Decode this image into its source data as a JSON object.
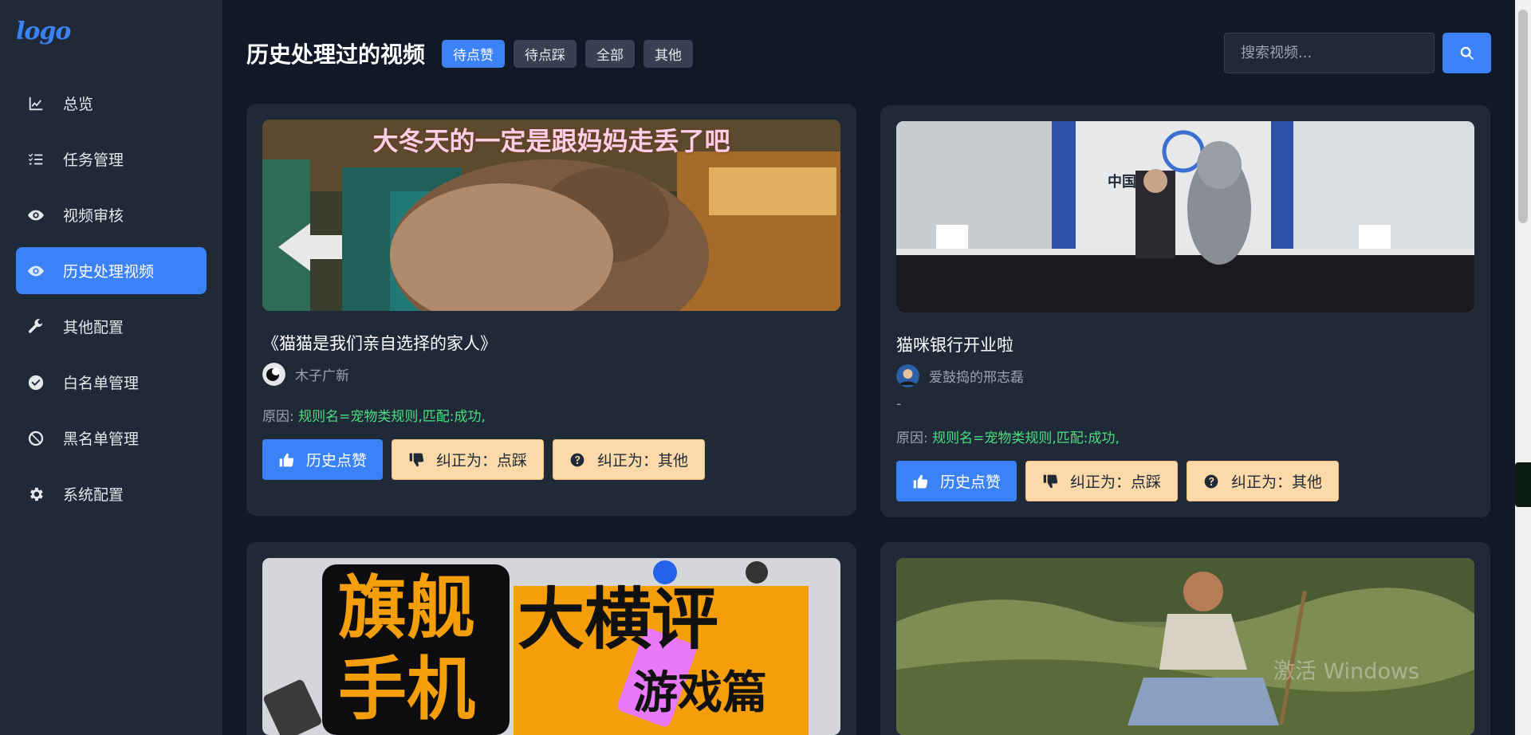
{
  "sidebar": {
    "logo": "logo",
    "items": [
      {
        "label": "总览",
        "icon": "chart-line-icon"
      },
      {
        "label": "任务管理",
        "icon": "task-list-icon"
      },
      {
        "label": "视频审核",
        "icon": "eye-icon"
      },
      {
        "label": "历史处理视频",
        "icon": "eye-icon",
        "active": true
      },
      {
        "label": "其他配置",
        "icon": "wrench-icon"
      },
      {
        "label": "白名单管理",
        "icon": "check-circle-icon"
      },
      {
        "label": "黑名单管理",
        "icon": "ban-icon"
      },
      {
        "label": "系统配置",
        "icon": "gear-icon"
      }
    ]
  },
  "header": {
    "title": "历史处理过的视频",
    "filters": [
      {
        "label": "待点赞",
        "active": true
      },
      {
        "label": "待点踩"
      },
      {
        "label": "全部"
      },
      {
        "label": "其他"
      }
    ],
    "search_placeholder": "搜索视频..."
  },
  "cards": [
    {
      "thumb_caption": "大冬天的一定是跟妈妈走丢了吧",
      "title": "《猫猫是我们亲自选择的家人》",
      "author": "木子广新",
      "desc": "",
      "reason_label": "原因:",
      "reason_value": "规则名=宠物类规则,匹配:成功,",
      "btn_like": "历史点赞",
      "btn_dislike": "纠正为：点踩",
      "btn_other": "纠正为：其他"
    },
    {
      "thumb_caption": "中国",
      "title": "猫咪银行开业啦",
      "author": "爱鼓捣的邢志磊",
      "desc": "-",
      "reason_label": "原因:",
      "reason_value": "规则名=宠物类规则,匹配:成功,",
      "btn_like": "历史点赞",
      "btn_dislike": "纠正为：点踩",
      "btn_other": "纠正为：其他"
    },
    {
      "thumb_text_1": "旗舰",
      "thumb_text_2": "手机",
      "thumb_text_3": "大横评",
      "thumb_text_4": "游戏篇"
    },
    {
      "thumb_caption": ""
    }
  ],
  "watermark": "激活 Windows",
  "colors": {
    "accent": "#3b82f6",
    "background": "#111827",
    "panel": "#1f2937",
    "reason_green": "#4ade80",
    "warn_button": "#fcd9a8"
  }
}
